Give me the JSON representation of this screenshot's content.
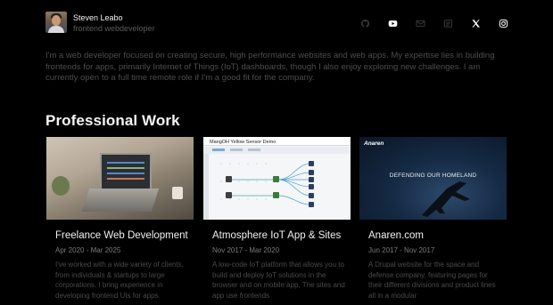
{
  "profile": {
    "name": "Steven Leabo",
    "role": "frontend webdeveloper"
  },
  "socials": [
    {
      "icon": "github-icon"
    },
    {
      "icon": "youtube-icon"
    },
    {
      "icon": "email-icon"
    },
    {
      "icon": "resume-icon"
    },
    {
      "icon": "x-twitter-icon"
    },
    {
      "icon": "instagram-icon"
    }
  ],
  "bio": "I'm a web developer focused on creating secure, high performance websites and web apps. My expertise lies in building frontends for apps, primarily Internet of Things (IoT) dashboards, though I also enjoy exploring new challenges. I am currently open to a full time remote role if I'm a good fit for the company.",
  "section": {
    "title": "Professional Work"
  },
  "projects": [
    {
      "title": "Freelance Web Development",
      "date": "Apr 2020 - Mar 2025",
      "desc": "I've worked with a wide variety of clients, from individuals & startups to large corporations. I bring experience in developing frontend UIs for apps"
    },
    {
      "title": "Atmosphere IoT App & Sites",
      "date": "Nov 2017 - Mar 2020",
      "desc": "A low-code IoT platform that allows you to build and deploy IoT solutions in the browser and on mobile app. The sites and app use frontends"
    },
    {
      "title": "Anaren.com",
      "date": "Jun 2017 - Nov 2017",
      "desc": "A Drupal website for the space and defense company, featuring pages for their different divisions and product lines all in a modular"
    }
  ],
  "thumbs": {
    "sensor_caption": "MangOH Yellow Sensor Demo",
    "anaren_brand": "Anaren",
    "anaren_tagline": "DEFENDING OUR HOMELAND"
  },
  "colors": {
    "background": "#000000",
    "heading": "#f4f4f4",
    "muted_text": "#4e4e4e",
    "icon_active": "#ffffff",
    "icon_dim": "#3a3a3a"
  }
}
